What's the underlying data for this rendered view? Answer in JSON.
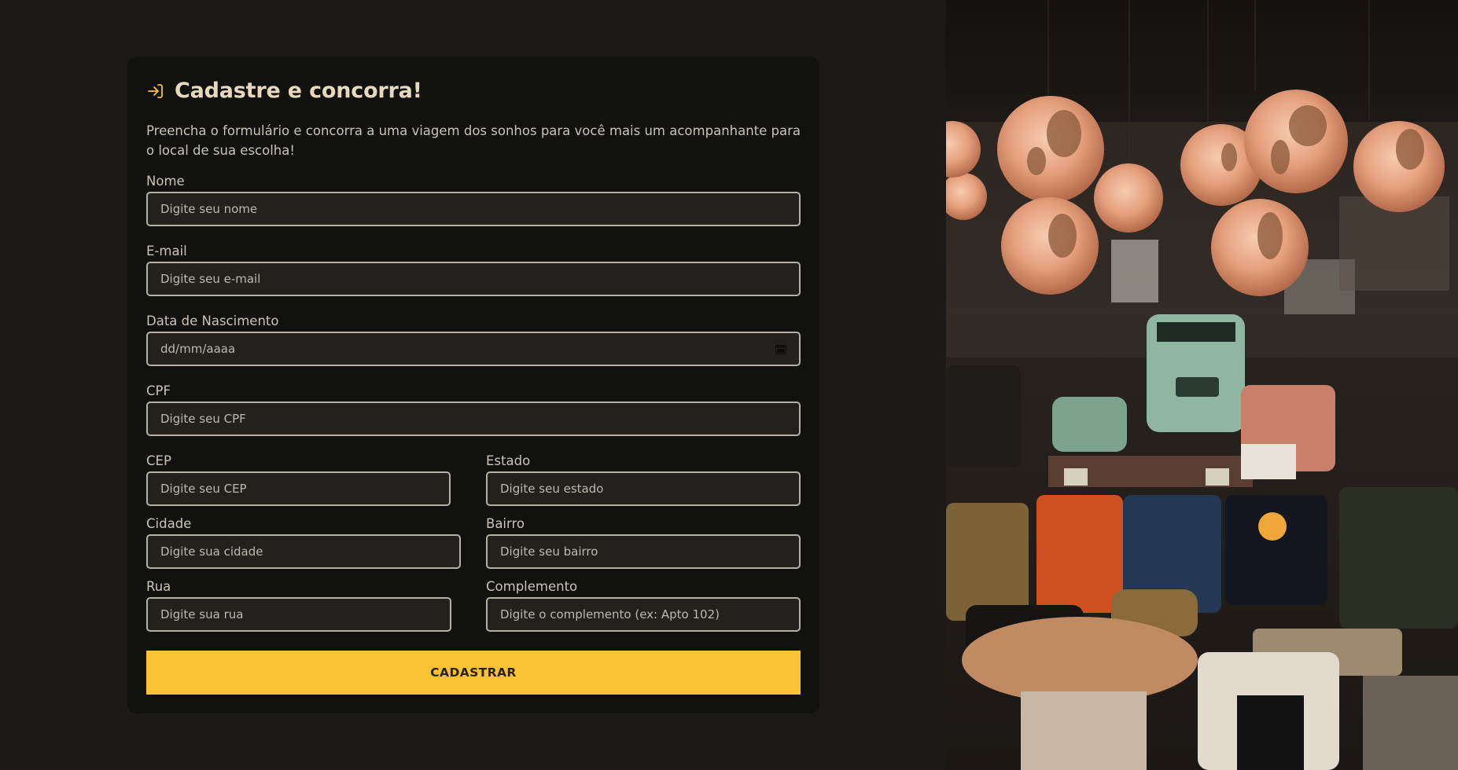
{
  "form": {
    "title": "Cadastre e concorra!",
    "description": "Preencha o formulário e concorra a uma viagem dos sonhos para você mais um acompanhante para o local de sua escolha!",
    "fields": {
      "nome": {
        "label": "Nome",
        "placeholder": "Digite seu nome"
      },
      "email": {
        "label": "E-mail",
        "placeholder": "Digite seu e-mail"
      },
      "nascimento": {
        "label": "Data de Nascimento",
        "placeholder": "dd/mm/aaaa"
      },
      "cpf": {
        "label": "CPF",
        "placeholder": "Digite seu CPF"
      },
      "cep": {
        "label": "CEP",
        "placeholder": "Digite seu CEP"
      },
      "estado": {
        "label": "Estado",
        "placeholder": "Digite seu estado"
      },
      "cidade": {
        "label": "Cidade",
        "placeholder": "Digite sua cidade"
      },
      "bairro": {
        "label": "Bairro",
        "placeholder": "Digite seu bairro"
      },
      "rua": {
        "label": "Rua",
        "placeholder": "Digite sua rua"
      },
      "complemento": {
        "label": "Complemento",
        "placeholder": "Digite o complemento (ex: Apto 102)"
      }
    },
    "submit_label": "CADASTRAR"
  },
  "icons": {
    "header": "login-arrow-icon",
    "date": "calendar-icon"
  },
  "colors": {
    "accent": "#f9c333",
    "background": "#1b1a18",
    "card": "#111110",
    "title": "#e7d9bd"
  },
  "image": {
    "subject": "globes-and-backpacks-photo"
  }
}
